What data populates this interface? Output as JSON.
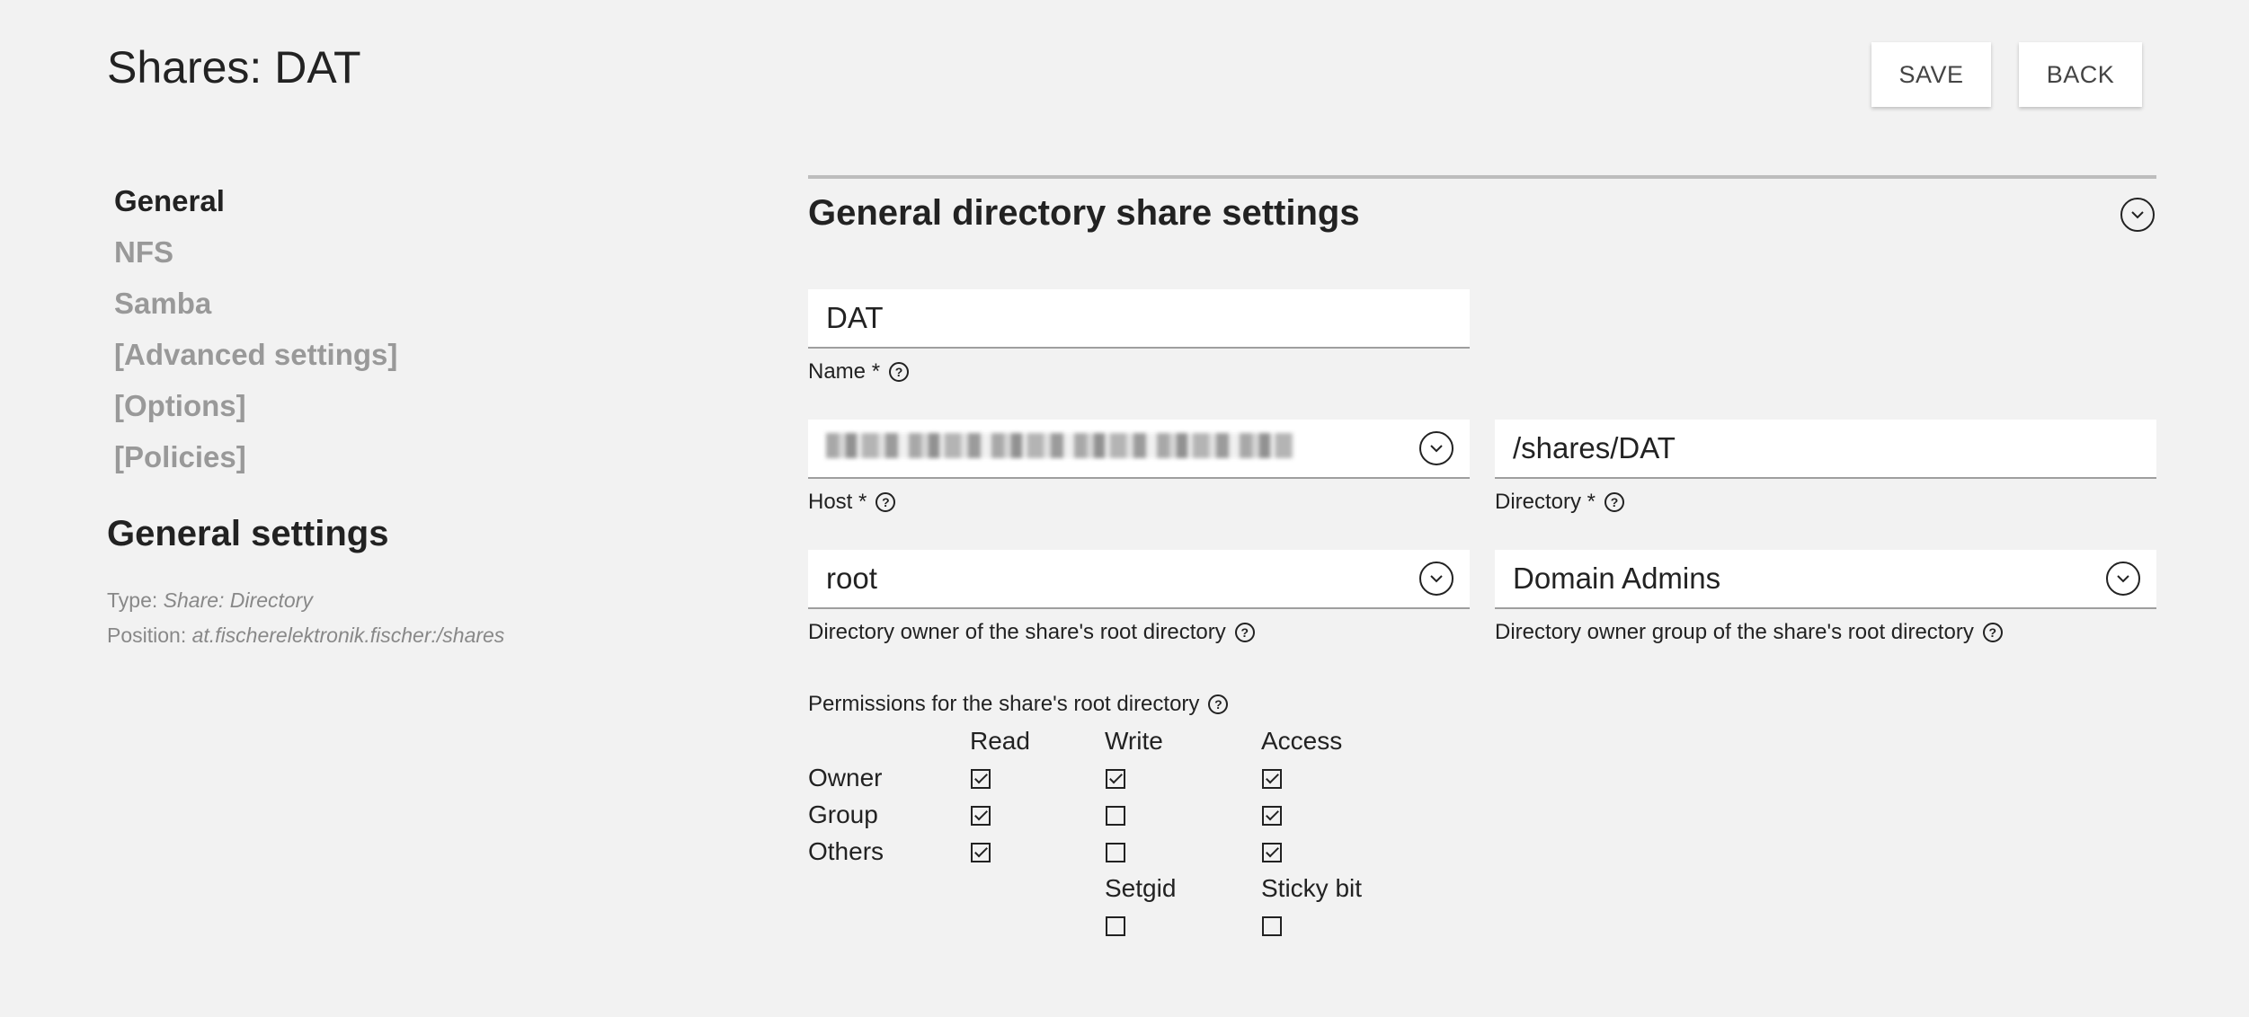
{
  "header": {
    "title": "Shares: DAT",
    "save_label": "SAVE",
    "back_label": "BACK"
  },
  "sidebar": {
    "items": [
      {
        "label": "General",
        "active": true
      },
      {
        "label": "NFS"
      },
      {
        "label": "Samba"
      },
      {
        "label": "[Advanced settings]"
      },
      {
        "label": "[Options]"
      },
      {
        "label": "[Policies]"
      }
    ],
    "general_settings": {
      "title": "General settings",
      "type_label": "Type:",
      "type_value": "Share: Directory",
      "position_label": "Position:",
      "position_value": "at.fischerelektronik.fischer:/shares"
    }
  },
  "section": {
    "title": "General directory share settings",
    "toggle_icon": "chevron-down-circle-icon"
  },
  "form": {
    "name": {
      "value": "DAT",
      "label": "Name *"
    },
    "host": {
      "label": "Host *"
    },
    "directory": {
      "value": "/shares/DAT",
      "label": "Directory *"
    },
    "owner": {
      "value": "root",
      "label": "Directory owner of the share's root directory"
    },
    "group": {
      "value": "Domain Admins",
      "label": "Directory owner group of the share's root directory"
    }
  },
  "permissions": {
    "label": "Permissions for the share's root directory",
    "columns": [
      "Read",
      "Write",
      "Access"
    ],
    "rows": [
      {
        "label": "Owner",
        "read": true,
        "write": true,
        "access": true
      },
      {
        "label": "Group",
        "read": true,
        "write": false,
        "access": true
      },
      {
        "label": "Others",
        "read": true,
        "write": false,
        "access": true
      }
    ],
    "special": [
      {
        "label": "Setgid",
        "checked": false
      },
      {
        "label": "Sticky bit",
        "checked": false
      }
    ]
  },
  "colors": {
    "background": "#f2f2f2",
    "text": "#222222",
    "muted": "#999999",
    "field_bg": "#ffffff"
  }
}
